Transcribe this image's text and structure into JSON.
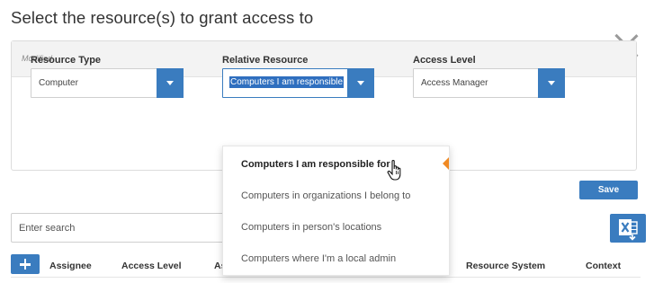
{
  "dialog": {
    "title": "Select the resource(s) to grant access to",
    "modified_label": "Modified"
  },
  "form": {
    "resource_type": {
      "label": "Resource Type",
      "value": "Computer"
    },
    "relative_resource": {
      "label": "Relative Resource",
      "value": "Computers I am responsible"
    },
    "access_level": {
      "label": "Access Level",
      "value": "Access Manager"
    }
  },
  "dropdown": {
    "options": [
      "Computers I am responsible for",
      "Computers in organizations I belong to",
      "Computers in person's locations",
      "Computers where I'm a local admin"
    ],
    "selected_index": 0
  },
  "actions": {
    "save_label": "Save"
  },
  "search": {
    "placeholder": "Enter search"
  },
  "table": {
    "columns": [
      "Assignee",
      "Access Level",
      "As",
      "Resource System",
      "Context"
    ]
  },
  "colors": {
    "accent": "#3a7cbf",
    "marker": "#f08a24",
    "selection": "#2f6fbf"
  },
  "icons": {
    "close": "close-icon",
    "excel": "excel-export-icon",
    "add": "plus-icon",
    "caret": "caret-down-icon",
    "cursor": "hand-pointer-icon"
  }
}
